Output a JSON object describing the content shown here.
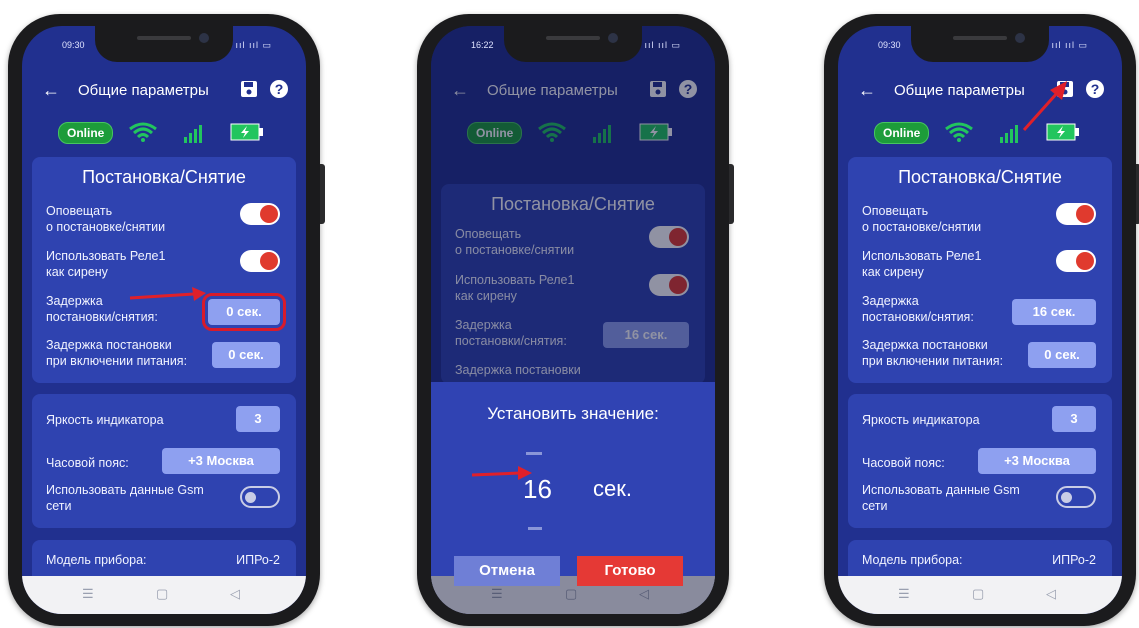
{
  "status": {
    "time1": "09:30",
    "time2": "16:22",
    "time3": "09:30",
    "signal": "ııl ııl ▭"
  },
  "header": {
    "back": "←",
    "title": "Общие параметры",
    "help": "?"
  },
  "badges": {
    "online": "Online"
  },
  "arming": {
    "title": "Постановка/Снятие",
    "notify_label_1": "Оповещать",
    "notify_label_2": "о постановке/снятии",
    "relay_label_1": "Использовать Реле1",
    "relay_label_2": "как сирену",
    "delay_label_1": "Задержка",
    "delay_label_2": "постановки/снятия:",
    "delay_value_before": "0 сек.",
    "delay_value_after": "16 сек.",
    "power_delay_label_1": "Задержка постановки",
    "power_delay_label_2": "при включении питания:",
    "power_delay_value": "0 сек."
  },
  "settings": {
    "brightness_label": "Яркость индикатора",
    "brightness_value": "3",
    "timezone_label": "Часовой пояс:",
    "timezone_value": "+3 Москва",
    "gsm_label_1": "Использовать данные Gsm",
    "gsm_label_2": "сети"
  },
  "device": {
    "model_label": "Модель прибора:",
    "model_value": "ИПРо-2"
  },
  "dialog": {
    "title": "Установить значение:",
    "value": "16",
    "unit": "сек.",
    "cancel": "Отмена",
    "done": "Готово"
  },
  "nav": {
    "menu": "☰",
    "home": "▢",
    "back": "◁"
  },
  "colors": {
    "screen_bg": "#21308f",
    "card_bg": "#2f43b0",
    "toggle_on": "#e03a2e",
    "value_btn": "#8ea0f0",
    "online": "#1d9c3a",
    "done_btn": "#e53935",
    "cancel_btn": "#6f7fd6",
    "annotation": "#e0202a"
  }
}
